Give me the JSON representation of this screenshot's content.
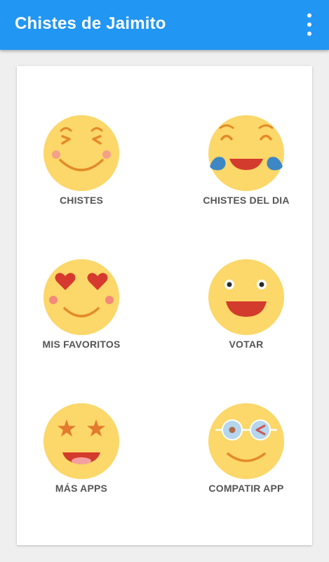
{
  "appbar": {
    "title": "Chistes de Jaimito",
    "color": "#2196f3"
  },
  "menu": {
    "icon": "more-vert-icon"
  },
  "grid": {
    "items": [
      {
        "label": "CHISTES",
        "icon": "laughing-emoji-icon"
      },
      {
        "label": "CHISTES DEL DIA",
        "icon": "tears-of-joy-emoji-icon"
      },
      {
        "label": "MIS FAVORITOS",
        "icon": "heart-eyes-emoji-icon"
      },
      {
        "label": "VOTAR",
        "icon": "grinning-emoji-icon"
      },
      {
        "label": "MÁS APPS",
        "icon": "star-eyes-emoji-icon"
      },
      {
        "label": "COMPATIR APP",
        "icon": "winking-glasses-emoji-icon"
      }
    ]
  },
  "colors": {
    "emoji_face": "#fcd769",
    "mouth": "#d33b2c",
    "tear": "#3d87c4",
    "label": "#555555"
  }
}
